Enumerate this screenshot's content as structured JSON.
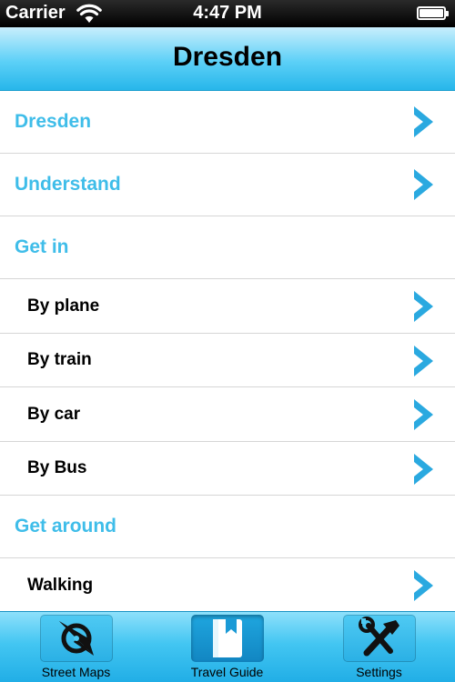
{
  "status_bar": {
    "carrier": "Carrier",
    "time": "4:47 PM",
    "wifi_icon": "wifi-icon",
    "battery_icon": "battery-icon",
    "battery_level": 1.0
  },
  "nav_bar": {
    "title": "Dresden"
  },
  "list": {
    "rows": [
      {
        "label": "Dresden",
        "kind": "section",
        "has_chevron": true
      },
      {
        "label": "Understand",
        "kind": "section",
        "has_chevron": true
      },
      {
        "label": "Get in",
        "kind": "section",
        "has_chevron": false
      },
      {
        "label": "By plane",
        "kind": "sub",
        "has_chevron": true
      },
      {
        "label": "By train",
        "kind": "sub",
        "has_chevron": true
      },
      {
        "label": "By car",
        "kind": "sub",
        "has_chevron": true
      },
      {
        "label": "By Bus",
        "kind": "sub",
        "has_chevron": true
      },
      {
        "label": "Get around",
        "kind": "section",
        "has_chevron": false
      },
      {
        "label": "Walking",
        "kind": "sub",
        "has_chevron": true
      }
    ]
  },
  "tab_bar": {
    "tabs": [
      {
        "label": "Street Maps",
        "icon": "compass-icon",
        "selected": false
      },
      {
        "label": "Travel Guide",
        "icon": "book-icon",
        "selected": true
      },
      {
        "label": "Settings",
        "icon": "tools-icon",
        "selected": false
      }
    ]
  },
  "colors": {
    "accent": "#3fbde9",
    "nav_gradient_top": "#c8eefc",
    "nav_gradient_bottom": "#27b6ea",
    "chevron": "#2aa9e0",
    "separator": "#d6d6d6"
  }
}
